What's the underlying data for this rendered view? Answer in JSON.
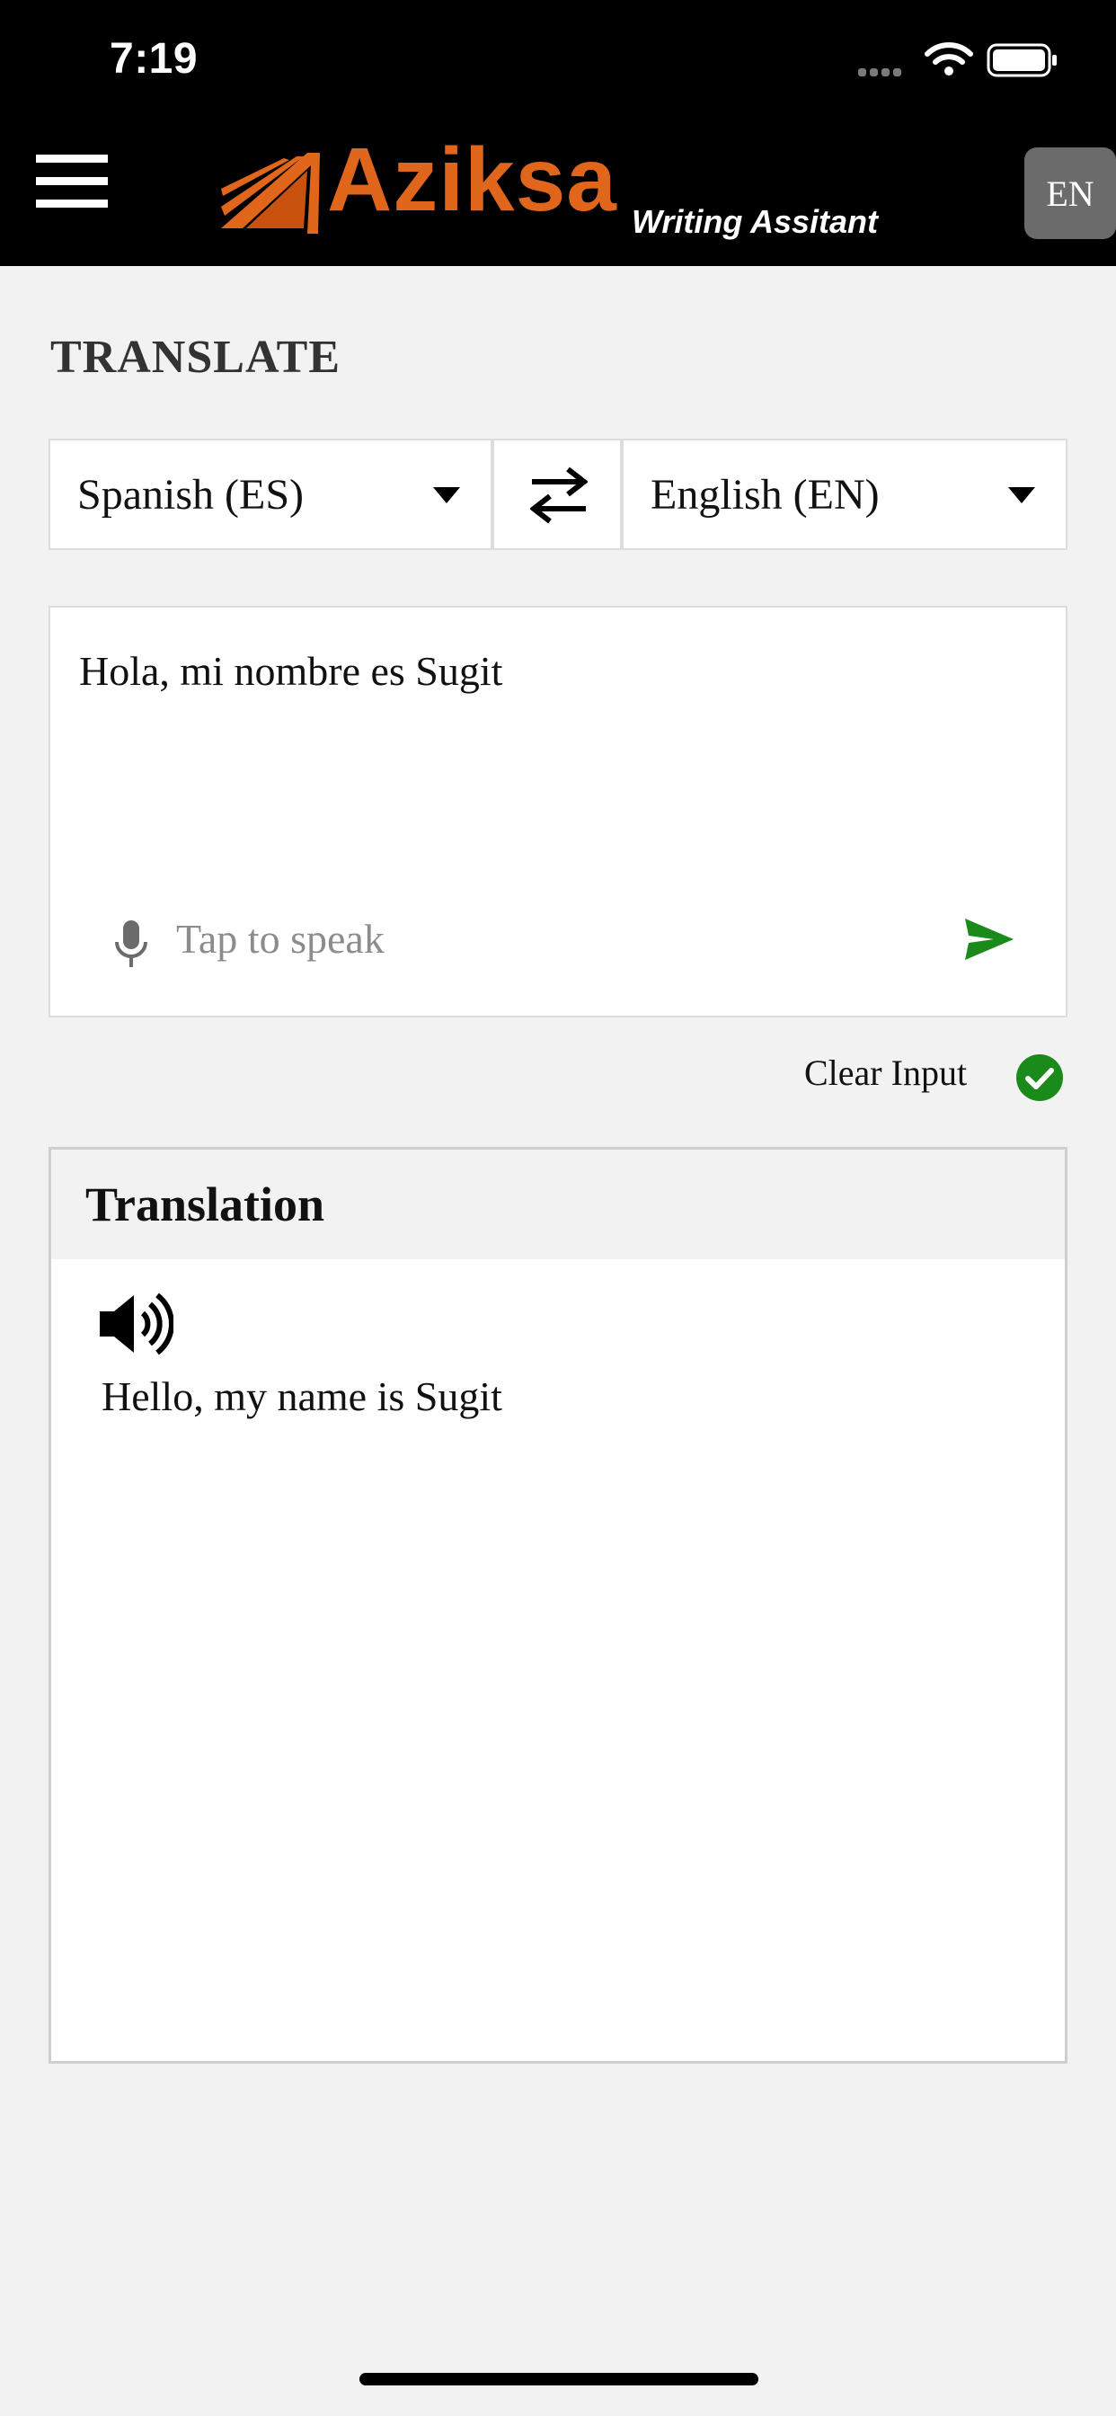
{
  "status_bar": {
    "time": "7:19"
  },
  "header": {
    "brand": "Aziksa",
    "tagline": "Writing Assitant",
    "language_button": "EN",
    "colors": {
      "brand": "#e0661c",
      "background": "#000000"
    }
  },
  "page": {
    "title": "TRANSLATE"
  },
  "languages": {
    "source": "Spanish (ES)",
    "target": "English (EN)"
  },
  "input": {
    "value": "Hola, mi nombre es Sugit",
    "speak_placeholder": "Tap to speak"
  },
  "clear": {
    "label": "Clear Input"
  },
  "translation": {
    "title": "Translation",
    "text": "Hello, my name is Sugit"
  },
  "icons": [
    "menu-icon",
    "swap-icon",
    "microphone-icon",
    "send-icon",
    "check-circle-icon",
    "speaker-icon"
  ],
  "accent": "#1a8a1a"
}
